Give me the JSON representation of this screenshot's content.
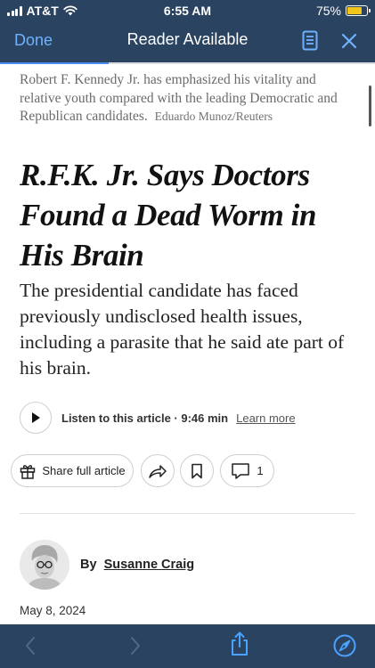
{
  "status_bar": {
    "carrier": "AT&T",
    "time": "6:55 AM",
    "battery": "75%",
    "battery_level": 0.75
  },
  "nav": {
    "done_label": "Done",
    "title": "Reader Available"
  },
  "reading_progress": 0.29,
  "article": {
    "caption": "Robert F. Kennedy Jr. has emphasized his vitality and relative youth compared with the leading Democratic and Republican candidates.",
    "caption_credit": "Eduardo Munoz/Reuters",
    "headline": "R.F.K. Jr. Says Doctors Found a Dead Worm in His Brain",
    "summary": "The presidential candidate has faced previously undisclosed health issues, including a parasite that he said ate part of his brain.",
    "listen": {
      "label": "Listen to this article · 9:46 min",
      "learn_more": "Learn more"
    },
    "actions": {
      "share_label": "Share full article",
      "comment_count": "1"
    },
    "byline": {
      "prefix": "By",
      "author": "Susanne Craig"
    },
    "date": "May 8, 2024"
  },
  "colors": {
    "chrome": "#2a4361",
    "link_blue": "#6fb2ff",
    "accent": "#4a8df0",
    "battery": "#f2c51c"
  },
  "icons": {
    "status": [
      "signal-icon",
      "wifi-icon",
      "battery-icon"
    ],
    "nav": [
      "reader-view-icon",
      "close-icon"
    ],
    "toolbar": [
      "back-icon",
      "forward-icon",
      "share-icon",
      "compass-icon"
    ]
  }
}
